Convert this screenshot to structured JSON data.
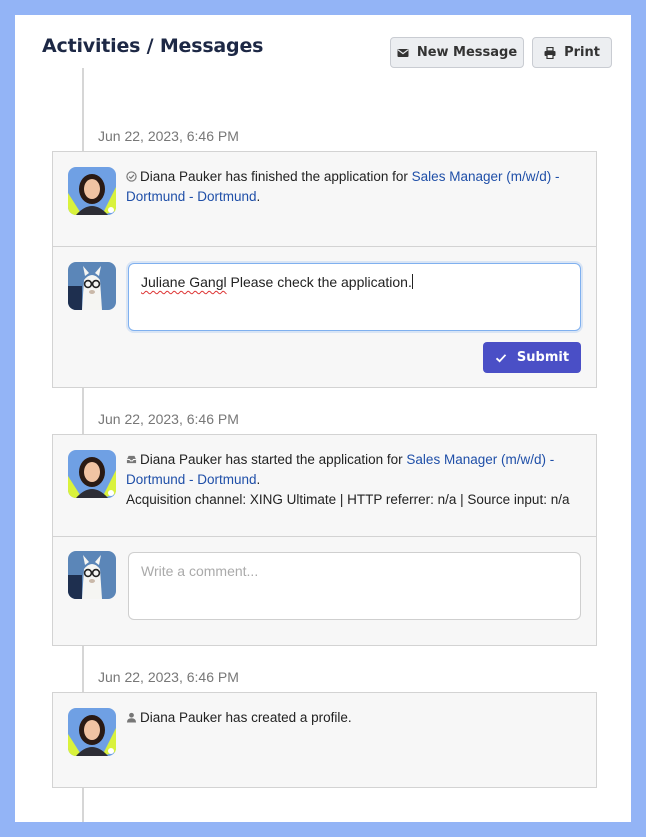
{
  "header": {
    "title": "Activities / Messages",
    "new_message_label": "New Message",
    "print_label": "Print"
  },
  "activities": [
    {
      "date": "Jun 22, 2023, 6:46 PM",
      "icon": "check-circle-icon",
      "text_before": "Diana Pauker has finished the application for ",
      "link": "Sales Manager (m/w/d) - Dortmund - Dortmund",
      "text_after": ".",
      "comment": {
        "mention": "Juliane Gangl",
        "text": " Please check the application.",
        "submit_label": "Submit"
      }
    },
    {
      "date": "Jun 22, 2023, 6:46 PM",
      "icon": "inbox-icon",
      "text_before": "Diana Pauker has started the application for ",
      "link": "Sales Manager (m/w/d) - Dortmund - Dortmund",
      "text_after": ".",
      "extra": "Acquisition channel: XING Ultimate | HTTP referrer: n/a | Source input: n/a",
      "comment": {
        "placeholder": "Write a comment..."
      }
    },
    {
      "date": "Jun 22, 2023, 6:46 PM",
      "icon": "user-icon",
      "text": "Diana Pauker has created a profile."
    }
  ],
  "colors": {
    "background": "#93b4f6",
    "title": "#1d2845",
    "link": "#1f4fa8",
    "submit": "#4a4fc6"
  }
}
